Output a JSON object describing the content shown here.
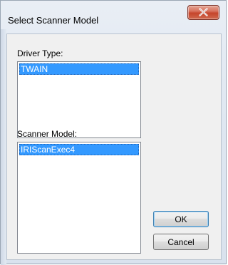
{
  "window": {
    "title": "Select Scanner Model",
    "close_icon": "close-icon"
  },
  "driver_type": {
    "label": "Driver Type:",
    "items": [
      "TWAIN"
    ],
    "selected": "TWAIN"
  },
  "scanner_model": {
    "label": "Scanner Model:",
    "items": [
      "IRIScanExec4"
    ],
    "selected": "IRIScanExec4"
  },
  "buttons": {
    "ok_label": "OK",
    "cancel_label": "Cancel"
  },
  "colors": {
    "selection": "#3399ff",
    "close_button": "#c5452c",
    "dialog_background": "#f0f0f0"
  }
}
